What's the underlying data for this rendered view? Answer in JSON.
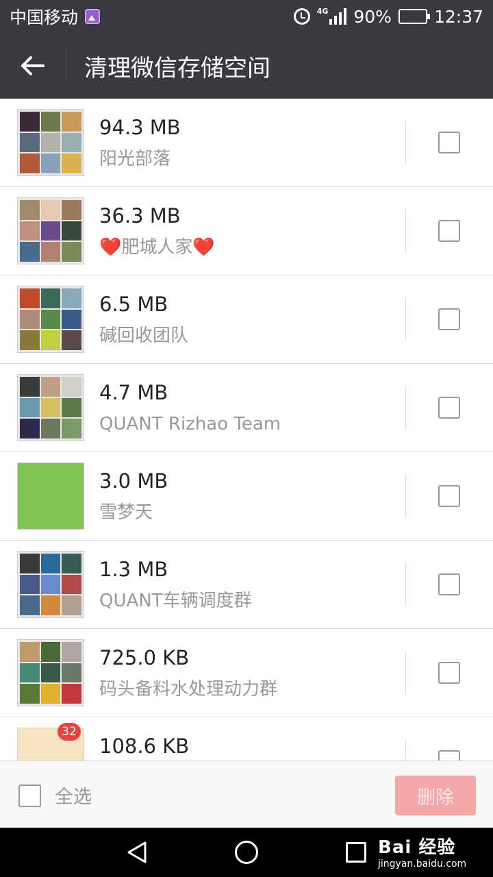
{
  "status_bar": {
    "carrier": "中国移动",
    "network": "4G",
    "battery": "90%",
    "battery_level": 0.9,
    "time": "12:37"
  },
  "header": {
    "title": "清理微信存储空间"
  },
  "items": [
    {
      "size": "94.3 MB",
      "name": "阳光部落",
      "checked": false,
      "avatar_colors": [
        "#3b2a3a",
        "#6d7a4a",
        "#c89a5a",
        "#5a6a7a",
        "#b0b4a8",
        "#9ab0b0",
        "#b05a3a",
        "#8aa0b8",
        "#d8b050"
      ]
    },
    {
      "size": "36.3 MB",
      "name_prefix": "❤️",
      "name": "肥城人家",
      "name_suffix": "❤️",
      "checked": false,
      "avatar_colors": [
        "#a08a6a",
        "#e8c8b0",
        "#9a7a5a",
        "#c09080",
        "#6a4a8a",
        "#3a4a3a",
        "#4a6a8a",
        "#b08070",
        "#7a8a5a"
      ]
    },
    {
      "size": "6.5 MB",
      "name": "碱回收团队",
      "checked": false,
      "avatar_colors": [
        "#c04a2a",
        "#3a6a5a",
        "#8aa8b8",
        "#b08a7a",
        "#5a8a4a",
        "#3a5a8a",
        "#8a7a3a",
        "#c0d040",
        "#5a4a4a"
      ]
    },
    {
      "size": "4.7 MB",
      "name": "QUANT Rizhao Team",
      "checked": false,
      "avatar_colors": [
        "#3a3a3a",
        "#c0a080",
        "#d0d0c8",
        "#6a9ab0",
        "#d8c060",
        "#5a7a4a",
        "#2a2a4a",
        "#6a7a5a",
        "#7a9a6a"
      ]
    },
    {
      "size": "3.0 MB",
      "name": "雪梦天",
      "checked": false,
      "single": true,
      "avatar_colors": [
        "#7fc454"
      ]
    },
    {
      "size": "1.3 MB",
      "name": "QUANT车辆调度群",
      "checked": false,
      "avatar_colors": [
        "#3a3a3a",
        "#2a6a9a",
        "#3a5a5a",
        "#4a5a8a",
        "#6a8ad0",
        "#b04a4a",
        "#4a6a8a",
        "#d08a3a",
        "#b0a090"
      ]
    },
    {
      "size": "725.0 KB",
      "name": "码头备料水处理动力群",
      "checked": false,
      "avatar_colors": [
        "#c09a6a",
        "#4a6a3a",
        "#b0a8a0",
        "#4a8a7a",
        "#3a5a4a",
        "#6a7a6a",
        "#5a7a3a",
        "#e0b030",
        "#c03a3a"
      ]
    },
    {
      "size": "108.6 KB",
      "name": "",
      "checked": false,
      "single": true,
      "badge": "32",
      "avatar_colors": [
        "#f6e3c0"
      ]
    }
  ],
  "footer": {
    "select_all_label": "全选",
    "delete_label": "删除"
  },
  "watermark": {
    "brand": "Bai  经验",
    "url": "jingyan.baidu.com"
  },
  "icons": [
    "gallery-icon",
    "alarm-icon",
    "signal-icon",
    "battery-icon",
    "back-arrow-icon",
    "nav-back-icon",
    "nav-home-icon",
    "nav-recent-icon"
  ]
}
